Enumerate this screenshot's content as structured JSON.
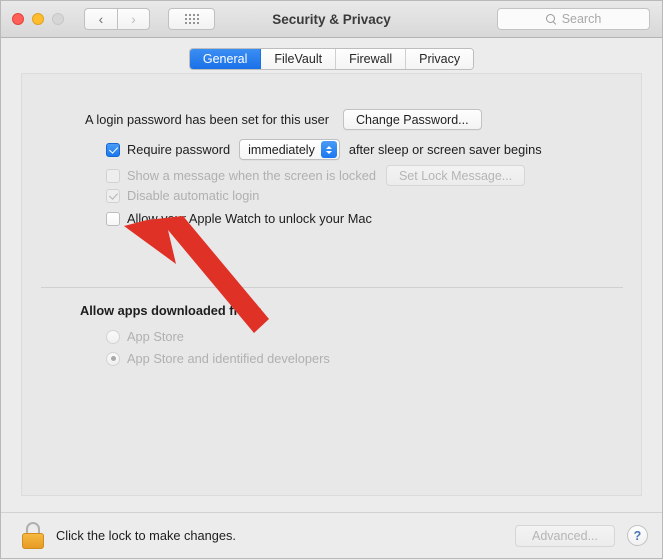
{
  "window": {
    "title": "Security & Privacy",
    "traffic_lights": [
      "close",
      "minimize",
      "zoom"
    ],
    "nav_back": "‹",
    "nav_forward": "›",
    "grid_icon": "show-all-grid-icon",
    "search": {
      "placeholder": "Search",
      "value": "",
      "icon": "search-icon"
    }
  },
  "tabs": [
    {
      "label": "General",
      "active": true
    },
    {
      "label": "FileVault",
      "active": false
    },
    {
      "label": "Firewall",
      "active": false
    },
    {
      "label": "Privacy",
      "active": false
    }
  ],
  "general": {
    "password_status": "A login password has been set for this user",
    "change_password_button": "Change Password...",
    "require_password": {
      "label": "Require password",
      "checked": true,
      "enabled": true,
      "delay_value": "immediately",
      "suffix": "after sleep or screen saver begins"
    },
    "show_message": {
      "label": "Show a message when the screen is locked",
      "checked": false,
      "enabled": false,
      "button": "Set Lock Message..."
    },
    "disable_auto_login": {
      "label": "Disable automatic login",
      "checked": true,
      "enabled": false
    },
    "apple_watch": {
      "label": "Allow your Apple Watch to unlock your Mac",
      "checked": false,
      "enabled": true
    },
    "allow_apps_heading": "Allow apps downloaded from:",
    "allow_apps_options": [
      {
        "label": "App Store",
        "selected": false,
        "enabled": false
      },
      {
        "label": "App Store and identified developers",
        "selected": true,
        "enabled": false
      }
    ]
  },
  "bottom": {
    "lock_icon": "lock-closed-icon",
    "lock_text": "Click the lock to make changes.",
    "advanced_button": "Advanced...",
    "help_button": "?"
  },
  "annotation": {
    "arrow": "red-arrow-pointing-to-apple-watch-checkbox",
    "color": "#e03127"
  }
}
